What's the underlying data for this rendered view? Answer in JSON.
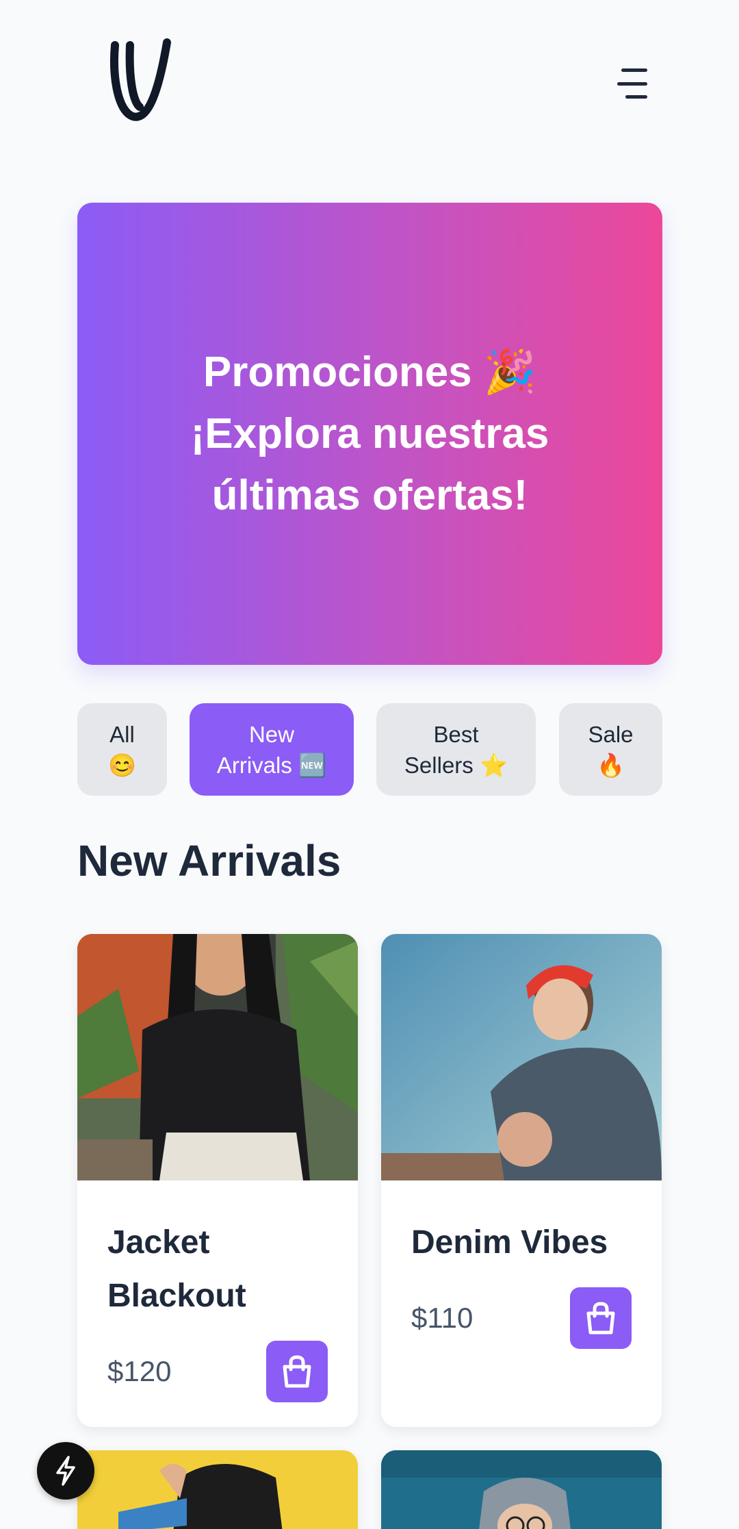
{
  "header": {
    "logo_icon": "v-logo",
    "menu_icon": "menu-icon"
  },
  "hero": {
    "lines": [
      "Promociones 🎉",
      "¡Explora nuestras",
      "últimas ofertas!"
    ]
  },
  "filters": [
    {
      "line1": "All",
      "line2": "😊",
      "active": false
    },
    {
      "line1": "New",
      "line2": "Arrivals 🆕",
      "active": true
    },
    {
      "line1": "Best",
      "line2": "Sellers ⭐",
      "active": false
    },
    {
      "line1": "Sale",
      "line2": "🔥",
      "active": false
    }
  ],
  "section": {
    "title": "New Arrivals"
  },
  "products": [
    {
      "name_line1": "Jacket",
      "name_line2": "Blackout",
      "price": "$120"
    },
    {
      "name_line1": "Denim Vibes",
      "name_line2": "",
      "price": "$110"
    }
  ],
  "colors": {
    "accent": "#8b5cf6",
    "gradient_end": "#ec4899",
    "text_dark": "#1e293b",
    "chip_bg": "#e5e7eb"
  }
}
